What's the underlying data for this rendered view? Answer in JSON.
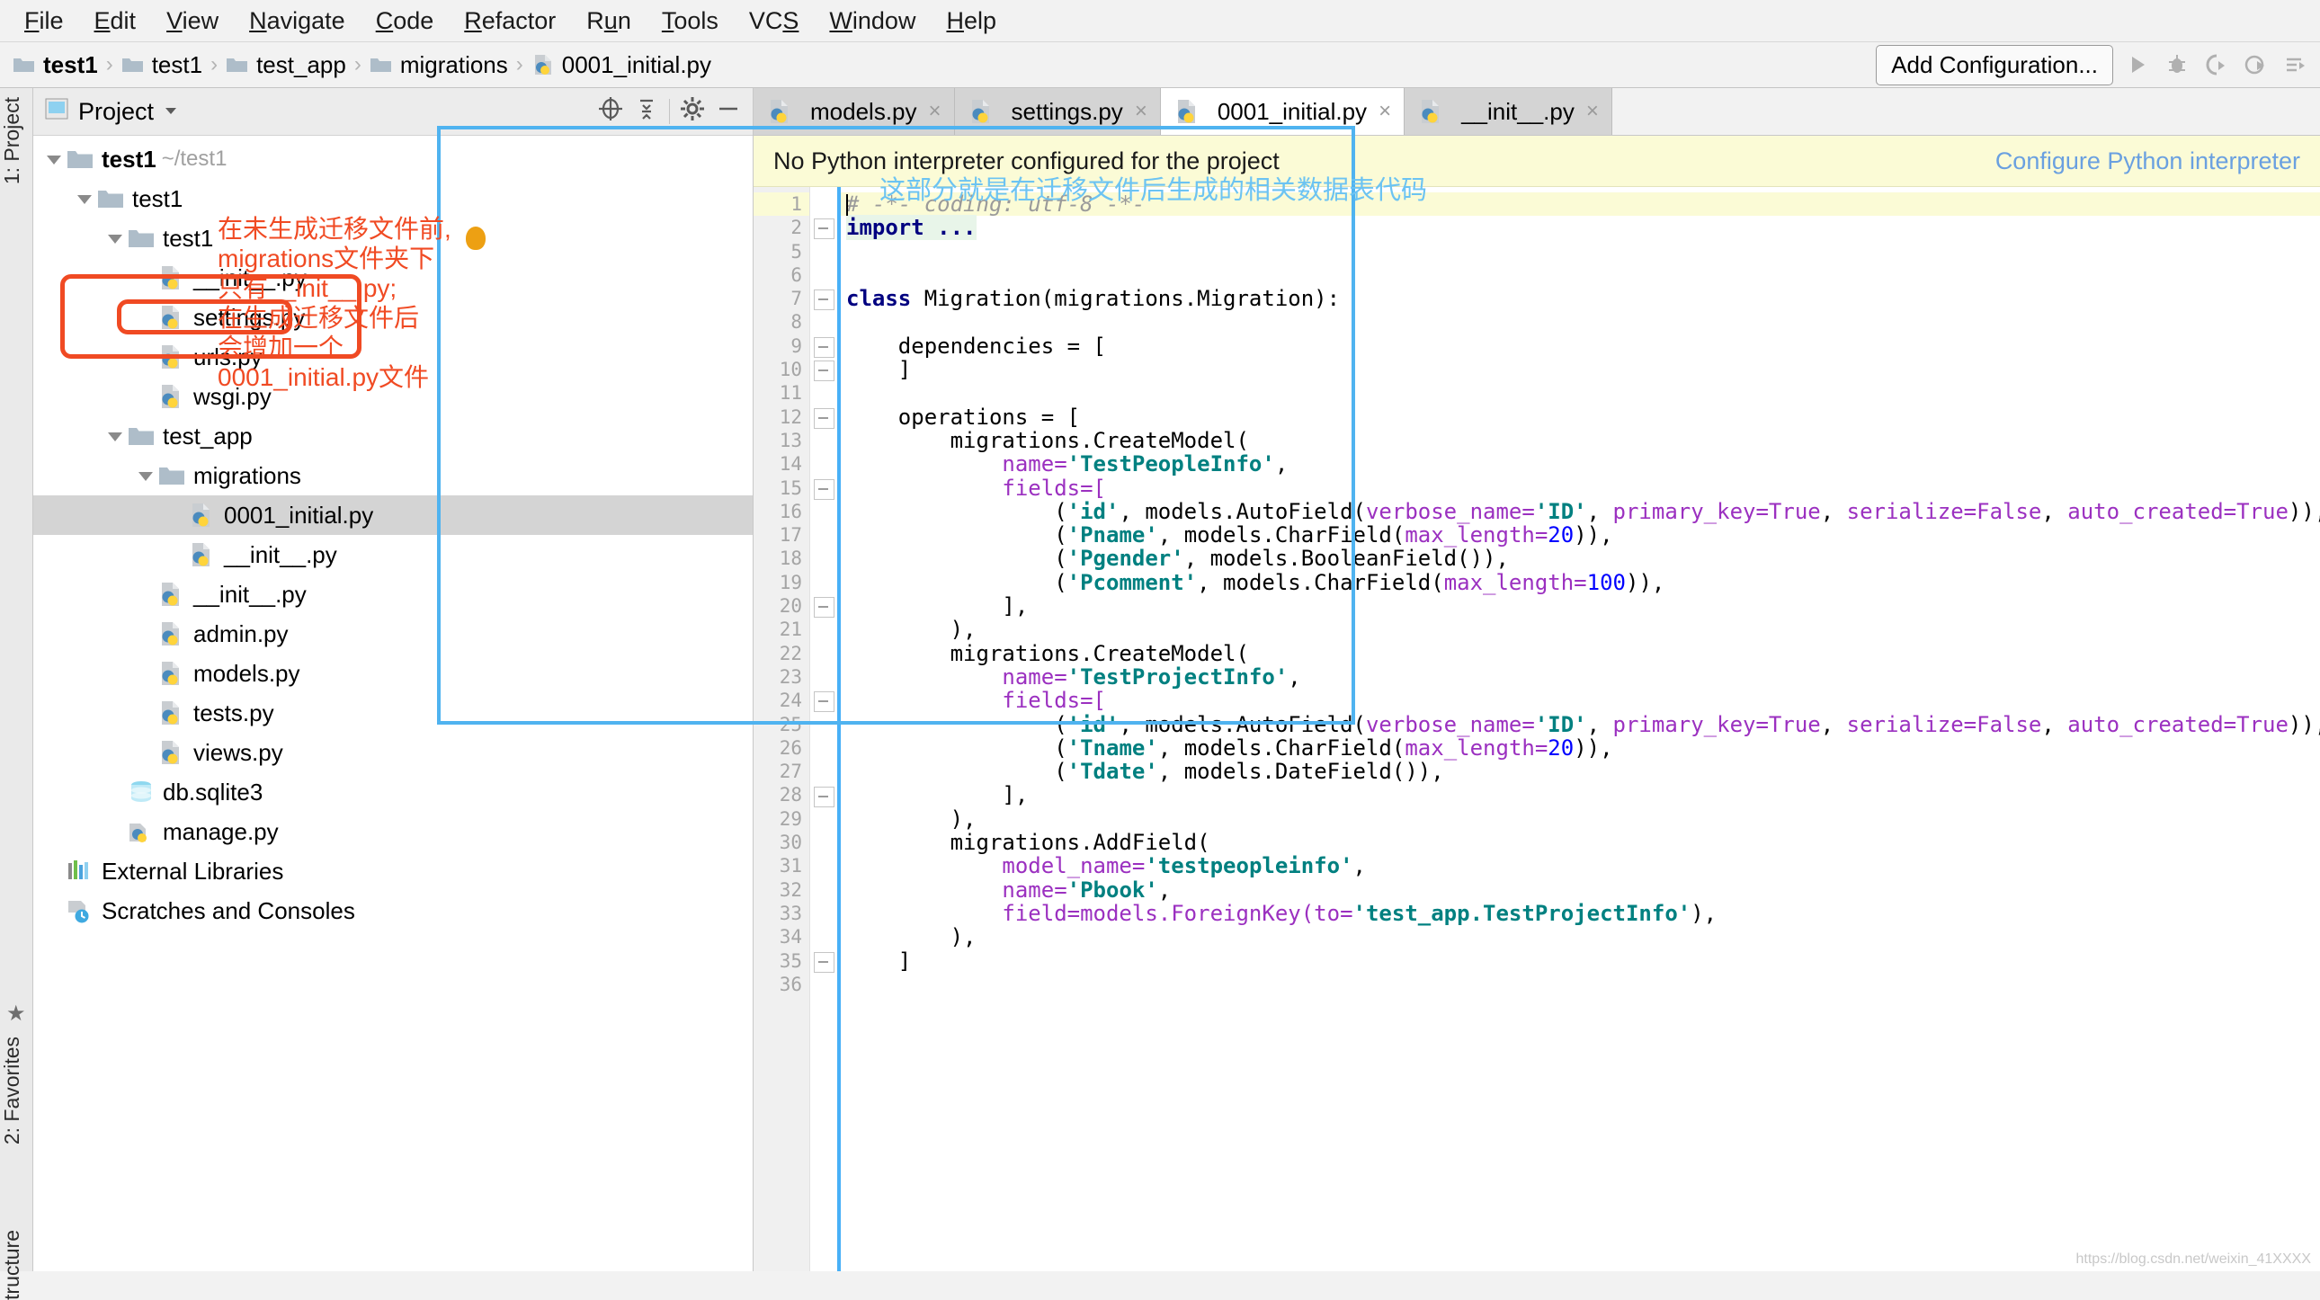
{
  "menu": {
    "items": [
      "File",
      "Edit",
      "View",
      "Navigate",
      "Code",
      "Refactor",
      "Run",
      "Tools",
      "VCS",
      "Window",
      "Help"
    ]
  },
  "breadcrumb": {
    "items": [
      "test1",
      "test1",
      "test_app",
      "migrations",
      "0001_initial.py"
    ],
    "separator": "›"
  },
  "toolbar": {
    "add_configuration": "Add Configuration...",
    "icons": [
      "run-icon",
      "debug-icon",
      "run-coverage-icon",
      "profile-icon",
      "run-anything-icon"
    ]
  },
  "left_strip": {
    "project_label": "1: Project",
    "favorites_label": "2: Favorites",
    "structure_label": "tructure"
  },
  "project_panel": {
    "title": "Project",
    "header_icons": [
      "locate-icon",
      "collapse-all-icon",
      "gear-icon",
      "hide-icon"
    ],
    "tree": [
      {
        "label": "test1",
        "path": "~/test1",
        "icon": "folder-icon",
        "depth": 0,
        "expanded": true,
        "bold": true
      },
      {
        "label": "test1",
        "path": "",
        "icon": "folder-icon",
        "depth": 1,
        "expanded": true,
        "bold": false
      },
      {
        "label": "test1",
        "path": "",
        "icon": "folder-icon",
        "depth": 2,
        "expanded": true,
        "bold": false
      },
      {
        "label": "__init__.py",
        "path": "",
        "icon": "python-file-icon",
        "depth": 3,
        "expanded": null,
        "bold": false
      },
      {
        "label": "settings.py",
        "path": "",
        "icon": "python-file-icon",
        "depth": 3,
        "expanded": null,
        "bold": false
      },
      {
        "label": "urls.py",
        "path": "",
        "icon": "python-file-icon",
        "depth": 3,
        "expanded": null,
        "bold": false
      },
      {
        "label": "wsgi.py",
        "path": "",
        "icon": "python-file-icon",
        "depth": 3,
        "expanded": null,
        "bold": false
      },
      {
        "label": "test_app",
        "path": "",
        "icon": "folder-icon",
        "depth": 2,
        "expanded": true,
        "bold": false
      },
      {
        "label": "migrations",
        "path": "",
        "icon": "folder-icon",
        "depth": 3,
        "expanded": true,
        "bold": false
      },
      {
        "label": "0001_initial.py",
        "path": "",
        "icon": "python-file-icon",
        "depth": 4,
        "expanded": null,
        "bold": false,
        "selected": true
      },
      {
        "label": "__init__.py",
        "path": "",
        "icon": "python-file-icon",
        "depth": 4,
        "expanded": null,
        "bold": false
      },
      {
        "label": "__init__.py",
        "path": "",
        "icon": "python-file-icon",
        "depth": 3,
        "expanded": null,
        "bold": false
      },
      {
        "label": "admin.py",
        "path": "",
        "icon": "python-file-icon",
        "depth": 3,
        "expanded": null,
        "bold": false
      },
      {
        "label": "models.py",
        "path": "",
        "icon": "python-file-icon",
        "depth": 3,
        "expanded": null,
        "bold": false
      },
      {
        "label": "tests.py",
        "path": "",
        "icon": "python-file-icon",
        "depth": 3,
        "expanded": null,
        "bold": false
      },
      {
        "label": "views.py",
        "path": "",
        "icon": "python-file-icon",
        "depth": 3,
        "expanded": null,
        "bold": false
      },
      {
        "label": "db.sqlite3",
        "path": "",
        "icon": "database-icon",
        "depth": 2,
        "expanded": null,
        "bold": false
      },
      {
        "label": "manage.py",
        "path": "",
        "icon": "python-script-icon",
        "depth": 2,
        "expanded": null,
        "bold": false
      },
      {
        "label": "External Libraries",
        "path": "",
        "icon": "libraries-icon",
        "depth": 0,
        "expanded": null,
        "bold": false
      },
      {
        "label": "Scratches and Consoles",
        "path": "",
        "icon": "scratches-icon",
        "depth": 0,
        "expanded": null,
        "bold": false
      }
    ]
  },
  "editor": {
    "tabs": [
      {
        "label": "models.py",
        "active": false
      },
      {
        "label": "settings.py",
        "active": false
      },
      {
        "label": "0001_initial.py",
        "active": true
      },
      {
        "label": "__init__.py",
        "active": false
      }
    ],
    "tab_close": "×",
    "notification": {
      "message": "No Python interpreter configured for the project",
      "link": "Configure Python interpreter"
    },
    "first_line_number": 1,
    "last_line_number": 36,
    "lines": [
      {
        "n": 1,
        "highlight": true,
        "tokens": [
          {
            "t": "# -*- coding: utf-8 -*-",
            "c": "c-com"
          }
        ]
      },
      {
        "n": 2,
        "highlight": false,
        "fold": true,
        "tokens": [
          {
            "t": "import ...",
            "c": "c-kw importhl"
          }
        ]
      },
      {
        "n": 5,
        "highlight": false,
        "tokens": []
      },
      {
        "n": 6,
        "highlight": false,
        "tokens": []
      },
      {
        "n": 7,
        "highlight": false,
        "fold": true,
        "tokens": [
          {
            "t": "class ",
            "c": "c-kw"
          },
          {
            "t": "Migration(migrations.Migration):",
            "c": "c-plain"
          }
        ]
      },
      {
        "n": 8,
        "highlight": false,
        "tokens": []
      },
      {
        "n": 9,
        "highlight": false,
        "fold": true,
        "tokens": [
          {
            "t": "    dependencies = [",
            "c": "c-plain"
          }
        ]
      },
      {
        "n": 10,
        "highlight": false,
        "fold": true,
        "tokens": [
          {
            "t": "    ]",
            "c": "c-plain"
          }
        ]
      },
      {
        "n": 11,
        "highlight": false,
        "tokens": []
      },
      {
        "n": 12,
        "highlight": false,
        "fold": true,
        "tokens": [
          {
            "t": "    operations = [",
            "c": "c-plain"
          }
        ]
      },
      {
        "n": 13,
        "highlight": false,
        "tokens": [
          {
            "t": "        migrations.CreateModel(",
            "c": "c-plain"
          }
        ]
      },
      {
        "n": 14,
        "highlight": false,
        "tokens": [
          {
            "t": "            name=",
            "c": "c-kwarg"
          },
          {
            "t": "'TestPeopleInfo'",
            "c": "c-str"
          },
          {
            "t": ",",
            "c": "c-plain"
          }
        ]
      },
      {
        "n": 15,
        "highlight": false,
        "fold": true,
        "tokens": [
          {
            "t": "            fields=[",
            "c": "c-kwarg"
          }
        ]
      },
      {
        "n": 16,
        "highlight": false,
        "tokens": [
          {
            "t": "                (",
            "c": "c-plain"
          },
          {
            "t": "'id'",
            "c": "c-str"
          },
          {
            "t": ", models.AutoField(",
            "c": "c-plain"
          },
          {
            "t": "verbose_name=",
            "c": "c-kwarg"
          },
          {
            "t": "'ID'",
            "c": "c-str"
          },
          {
            "t": ", ",
            "c": "c-plain"
          },
          {
            "t": "primary_key=",
            "c": "c-kwarg"
          },
          {
            "t": "True",
            "c": "c-const"
          },
          {
            "t": ", ",
            "c": "c-plain"
          },
          {
            "t": "serialize=",
            "c": "c-kwarg"
          },
          {
            "t": "False",
            "c": "c-const"
          },
          {
            "t": ", ",
            "c": "c-plain"
          },
          {
            "t": "auto_created=",
            "c": "c-kwarg"
          },
          {
            "t": "True",
            "c": "c-const"
          },
          {
            "t": ")),",
            "c": "c-plain"
          }
        ]
      },
      {
        "n": 17,
        "highlight": false,
        "tokens": [
          {
            "t": "                (",
            "c": "c-plain"
          },
          {
            "t": "'Pname'",
            "c": "c-str"
          },
          {
            "t": ", models.CharField(",
            "c": "c-plain"
          },
          {
            "t": "max_length=",
            "c": "c-kwarg"
          },
          {
            "t": "20",
            "c": "c-num"
          },
          {
            "t": ")),",
            "c": "c-plain"
          }
        ]
      },
      {
        "n": 18,
        "highlight": false,
        "tokens": [
          {
            "t": "                (",
            "c": "c-plain"
          },
          {
            "t": "'Pgender'",
            "c": "c-str"
          },
          {
            "t": ", models.BooleanField()),",
            "c": "c-plain"
          }
        ]
      },
      {
        "n": 19,
        "highlight": false,
        "tokens": [
          {
            "t": "                (",
            "c": "c-plain"
          },
          {
            "t": "'Pcomment'",
            "c": "c-str"
          },
          {
            "t": ", models.CharField(",
            "c": "c-plain"
          },
          {
            "t": "max_length=",
            "c": "c-kwarg"
          },
          {
            "t": "100",
            "c": "c-num"
          },
          {
            "t": ")),",
            "c": "c-plain"
          }
        ]
      },
      {
        "n": 20,
        "highlight": false,
        "fold": true,
        "tokens": [
          {
            "t": "            ],",
            "c": "c-plain"
          }
        ]
      },
      {
        "n": 21,
        "highlight": false,
        "tokens": [
          {
            "t": "        ),",
            "c": "c-plain"
          }
        ]
      },
      {
        "n": 22,
        "highlight": false,
        "tokens": [
          {
            "t": "        migrations.CreateModel(",
            "c": "c-plain"
          }
        ]
      },
      {
        "n": 23,
        "highlight": false,
        "tokens": [
          {
            "t": "            name=",
            "c": "c-kwarg"
          },
          {
            "t": "'TestProjectInfo'",
            "c": "c-str"
          },
          {
            "t": ",",
            "c": "c-plain"
          }
        ]
      },
      {
        "n": 24,
        "highlight": false,
        "fold": true,
        "tokens": [
          {
            "t": "            fields=[",
            "c": "c-kwarg"
          }
        ]
      },
      {
        "n": 25,
        "highlight": false,
        "tokens": [
          {
            "t": "                (",
            "c": "c-plain"
          },
          {
            "t": "'id'",
            "c": "c-str"
          },
          {
            "t": ", models.AutoField(",
            "c": "c-plain"
          },
          {
            "t": "verbose_name=",
            "c": "c-kwarg"
          },
          {
            "t": "'ID'",
            "c": "c-str"
          },
          {
            "t": ", ",
            "c": "c-plain"
          },
          {
            "t": "primary_key=",
            "c": "c-kwarg"
          },
          {
            "t": "True",
            "c": "c-const"
          },
          {
            "t": ", ",
            "c": "c-plain"
          },
          {
            "t": "serialize=",
            "c": "c-kwarg"
          },
          {
            "t": "False",
            "c": "c-const"
          },
          {
            "t": ", ",
            "c": "c-plain"
          },
          {
            "t": "auto_created=",
            "c": "c-kwarg"
          },
          {
            "t": "True",
            "c": "c-const"
          },
          {
            "t": ")),",
            "c": "c-plain"
          }
        ]
      },
      {
        "n": 26,
        "highlight": false,
        "tokens": [
          {
            "t": "                (",
            "c": "c-plain"
          },
          {
            "t": "'Tname'",
            "c": "c-str"
          },
          {
            "t": ", models.CharField(",
            "c": "c-plain"
          },
          {
            "t": "max_length=",
            "c": "c-kwarg"
          },
          {
            "t": "20",
            "c": "c-num"
          },
          {
            "t": ")),",
            "c": "c-plain"
          }
        ]
      },
      {
        "n": 27,
        "highlight": false,
        "tokens": [
          {
            "t": "                (",
            "c": "c-plain"
          },
          {
            "t": "'Tdate'",
            "c": "c-str"
          },
          {
            "t": ", models.DateField()),",
            "c": "c-plain"
          }
        ]
      },
      {
        "n": 28,
        "highlight": false,
        "fold": true,
        "tokens": [
          {
            "t": "            ],",
            "c": "c-plain"
          }
        ]
      },
      {
        "n": 29,
        "highlight": false,
        "tokens": [
          {
            "t": "        ),",
            "c": "c-plain"
          }
        ]
      },
      {
        "n": 30,
        "highlight": false,
        "tokens": [
          {
            "t": "        migrations.AddField(",
            "c": "c-plain"
          }
        ]
      },
      {
        "n": 31,
        "highlight": false,
        "tokens": [
          {
            "t": "            model_name=",
            "c": "c-kwarg"
          },
          {
            "t": "'testpeopleinfo'",
            "c": "c-str"
          },
          {
            "t": ",",
            "c": "c-plain"
          }
        ]
      },
      {
        "n": 32,
        "highlight": false,
        "tokens": [
          {
            "t": "            name=",
            "c": "c-kwarg"
          },
          {
            "t": "'Pbook'",
            "c": "c-str"
          },
          {
            "t": ",",
            "c": "c-plain"
          }
        ]
      },
      {
        "n": 33,
        "highlight": false,
        "tokens": [
          {
            "t": "            field=models.ForeignKey(",
            "c": "c-kwarg"
          },
          {
            "t": "to=",
            "c": "c-kwarg"
          },
          {
            "t": "'test_app.TestProjectInfo'",
            "c": "c-str"
          },
          {
            "t": "),",
            "c": "c-plain"
          }
        ]
      },
      {
        "n": 34,
        "highlight": false,
        "tokens": [
          {
            "t": "        ),",
            "c": "c-plain"
          }
        ]
      },
      {
        "n": 35,
        "highlight": false,
        "fold": true,
        "tokens": [
          {
            "t": "    ]",
            "c": "c-plain"
          }
        ]
      },
      {
        "n": 36,
        "highlight": false,
        "tokens": []
      }
    ]
  },
  "annotations": {
    "red_note": "在未生成迁移文件前,\nmigrations文件夹下\n只有__init__.py;\n在生成迁移文件后\n会增加一个\n0001_initial.py文件",
    "blue_note": "这部分就是在迁移文件后生成的相关数据表代码",
    "red_color": "#f04a23",
    "blue_color": "#6cc3f2"
  },
  "watermark": "https://blog.csdn.net/weixin_41XXXX"
}
